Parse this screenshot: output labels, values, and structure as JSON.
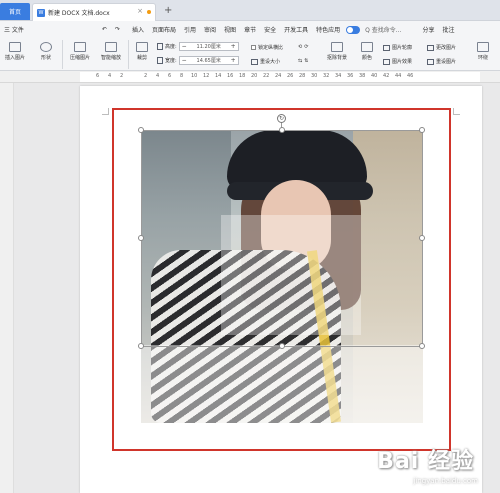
{
  "titlebar": {
    "home_tab": "首页",
    "doc_tab_title": "新建 DOCX 文档.docx",
    "doc_icon": "W"
  },
  "menu": {
    "file": "三 文件",
    "items": [
      "插入",
      "页面布局",
      "引用",
      "审阅",
      "视图",
      "章节",
      "安全",
      "开发工具",
      "特色应用"
    ],
    "search": "Q 查找命令...",
    "share": "分享",
    "comment": "批注"
  },
  "toolbar": {
    "insert_pic": "插入图片",
    "shape": "形状",
    "compress": "压缩图片",
    "smart_zoom": "智能缩放",
    "crop": "裁剪",
    "height_label": "高度:",
    "height_value": "11.20厘米",
    "width_label": "宽度:",
    "width_value": "14.65厘米",
    "lock_ratio": "锁定纵横比",
    "reset_size": "重设大小",
    "remove_bg": "抠除背景",
    "color": "颜色",
    "pic_outline": "图片轮廓",
    "pic_effect": "图片效果",
    "change_pic": "更改图片",
    "reset_pic": "重设图片",
    "wrap": "环绕"
  },
  "ruler": {
    "numbers": [
      "6",
      "4",
      "2",
      "2",
      "4",
      "6",
      "8",
      "10",
      "12",
      "14",
      "16",
      "18",
      "20",
      "22",
      "24",
      "26",
      "28",
      "30",
      "32",
      "34",
      "36",
      "38",
      "40",
      "42",
      "44",
      "46"
    ]
  },
  "watermark": {
    "text": "Bai 经验",
    "sub": "jingyan.baidu.com"
  },
  "colors": {
    "accent": "#3a7de0",
    "frame_red": "#d0352b"
  }
}
